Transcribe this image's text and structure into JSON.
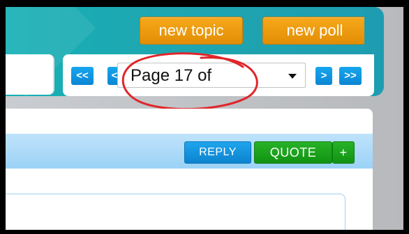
{
  "header": {
    "new_topic_label": "new topic",
    "new_poll_label": "new poll"
  },
  "pager": {
    "first_label": "<<",
    "prev_label": "<",
    "next_label": ">",
    "last_label": ">>",
    "selected_page_text": "Page 17 of"
  },
  "post": {
    "reply_label": "REPLY",
    "quote_label": "QUOTE",
    "plus_label": "+"
  },
  "colors": {
    "header_teal": "#1ea7b1",
    "orange_button": "#f0a010",
    "blue_button": "#1596e0",
    "green_button": "#1aa51a",
    "annotation_red": "#e0262a"
  }
}
